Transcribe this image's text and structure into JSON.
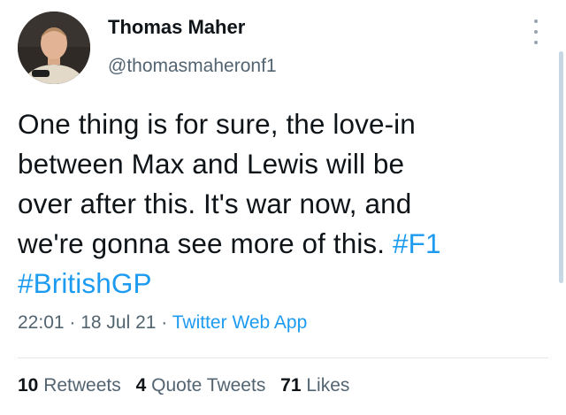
{
  "author": {
    "name": "Thomas Maher",
    "handle": "@thomasmaheronf1"
  },
  "tweet": {
    "lines": [
      "One thing is for sure, the love-in",
      "between Max and Lewis will be",
      "over after this. It's war now, and",
      "we're gonna see more of this. "
    ],
    "hashtag1": "#F1",
    "hashtag2": "#BritishGP"
  },
  "meta": {
    "time": "22:01",
    "sep1": " · ",
    "date": "18 Jul 21",
    "sep2": " · ",
    "source": "Twitter Web App"
  },
  "stats": {
    "retweets_count": "10",
    "retweets_label": "Retweets",
    "quotes_count": "4",
    "quotes_label": "Quote Tweets",
    "likes_count": "71",
    "likes_label": "Likes"
  },
  "colors": {
    "link": "#1d9bf0",
    "text": "#0f1419",
    "secondary": "#536471"
  },
  "icons": {
    "more": "more-vertical-icon"
  }
}
